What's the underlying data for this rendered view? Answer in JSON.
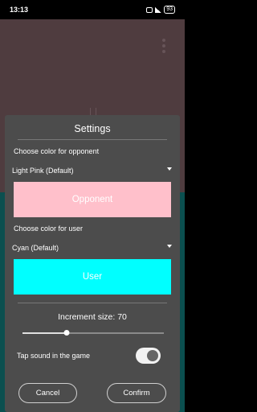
{
  "status_bar": {
    "time": "13:13",
    "battery": "93"
  },
  "settings_dialog": {
    "title": "Settings",
    "opponent": {
      "label": "Choose color for opponent",
      "selected": "Light Pink (Default)",
      "button_label": "Opponent",
      "color": "#ffc0cb"
    },
    "user": {
      "label": "Choose color for user",
      "selected": "Cyan (Default)",
      "button_label": "User",
      "color": "#00ffff"
    },
    "increment": {
      "label": "Increment size: 70",
      "value": 70,
      "slider_fraction": 0.31
    },
    "tap_sound": {
      "label": "Tap sound in the game",
      "enabled": true
    },
    "cancel_label": "Cancel",
    "confirm_label": "Confirm"
  },
  "background": {
    "opponent_area_color": "#6a5055",
    "user_area_color": "#0f6a6a"
  },
  "icons": [
    "box-icon",
    "signal-icon",
    "battery-icon",
    "more-vert-icon",
    "dropdown-arrow-icon"
  ]
}
